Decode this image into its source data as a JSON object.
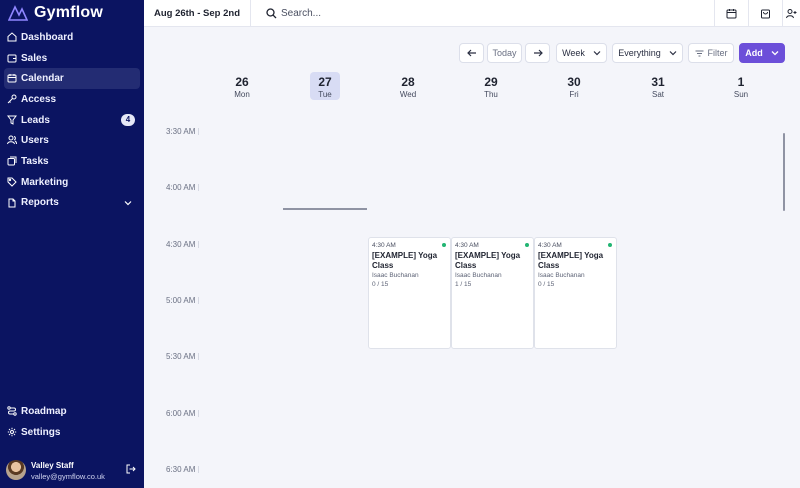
{
  "brand": {
    "name": "Gymflow"
  },
  "sidebar": {
    "items": [
      {
        "label": "Dashboard",
        "icon": "home-icon"
      },
      {
        "label": "Sales",
        "icon": "wallet-icon"
      },
      {
        "label": "Calendar",
        "icon": "calendar-icon",
        "active": true
      },
      {
        "label": "Access",
        "icon": "key-icon"
      },
      {
        "label": "Leads",
        "icon": "funnel-icon",
        "badge": "4"
      },
      {
        "label": "Users",
        "icon": "users-icon"
      },
      {
        "label": "Tasks",
        "icon": "tasks-icon"
      },
      {
        "label": "Marketing",
        "icon": "tag-icon"
      },
      {
        "label": "Reports",
        "icon": "reports-icon",
        "has_chevron": true
      }
    ],
    "bottom_items": [
      {
        "label": "Roadmap",
        "icon": "roadmap-icon"
      },
      {
        "label": "Settings",
        "icon": "gear-icon"
      }
    ],
    "user": {
      "name": "Valley Staff",
      "email": "valley@gymflow.co.uk"
    }
  },
  "topbar": {
    "date_range": "Aug 26th - Sep 2nd",
    "search_placeholder": "Search..."
  },
  "toolbar": {
    "today_label": "Today",
    "view_label": "Week",
    "filter_scope_label": "Everything",
    "filter_label": "Filter",
    "add_label": "Add"
  },
  "days": [
    {
      "num": "26",
      "name": "Mon"
    },
    {
      "num": "27",
      "name": "Tue",
      "today": true
    },
    {
      "num": "28",
      "name": "Wed"
    },
    {
      "num": "29",
      "name": "Thu"
    },
    {
      "num": "30",
      "name": "Fri"
    },
    {
      "num": "31",
      "name": "Sat"
    },
    {
      "num": "1",
      "name": "Sun"
    }
  ],
  "times": [
    "3:30 AM",
    "4:00 AM",
    "4:30 AM",
    "5:00 AM",
    "5:30 AM",
    "6:00 AM",
    "6:30 AM"
  ],
  "events": [
    {
      "time": "4:30 AM",
      "title": "[EXAMPLE] Yoga Class",
      "coach": "Isaac Buchanan",
      "count": "0 / 15"
    },
    {
      "time": "4:30 AM",
      "title": "[EXAMPLE] Yoga Class",
      "coach": "Isaac Buchanan",
      "count": "1 / 15"
    },
    {
      "time": "4:30 AM",
      "title": "[EXAMPLE] Yoga Class",
      "coach": "Isaac Buchanan",
      "count": "0 / 15"
    }
  ],
  "colors": {
    "sidebar_bg": "#0b1461",
    "accent": "#6c4fd9",
    "status_dot": "#22b573",
    "today_bg": "#d8dcf4"
  }
}
